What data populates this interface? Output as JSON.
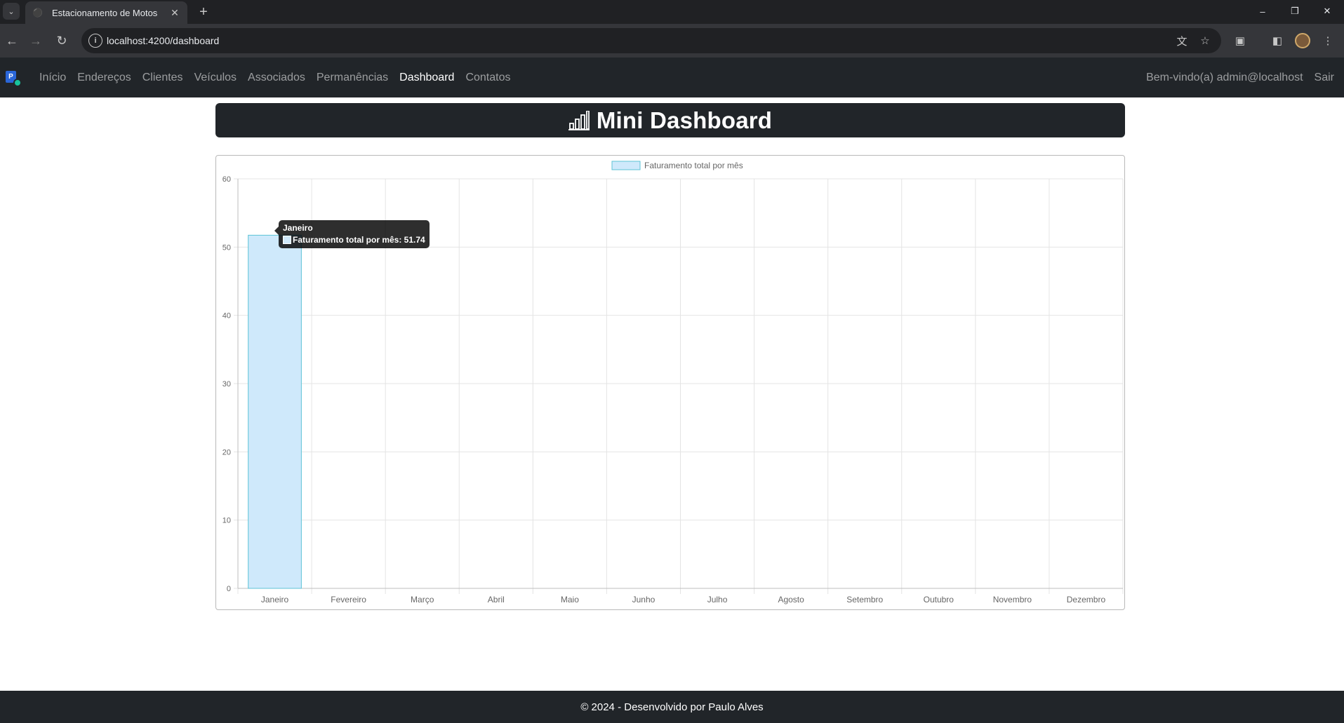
{
  "browser": {
    "tab_title": "Estacionamento de Motos",
    "url": "localhost:4200/dashboard",
    "icons": [
      "tab-search-icon",
      "motorcycle-favicon-icon",
      "close-icon",
      "plus-icon",
      "minimize-icon",
      "restore-icon",
      "close-window-icon",
      "back-icon",
      "forward-icon",
      "reload-icon",
      "site-info-icon",
      "translate-icon",
      "star-icon",
      "extensions-icon",
      "side-panel-icon",
      "profile-avatar",
      "more-menu-icon"
    ]
  },
  "navbar": {
    "links": [
      {
        "label": "Início",
        "active": false
      },
      {
        "label": "Endereços",
        "active": false
      },
      {
        "label": "Clientes",
        "active": false
      },
      {
        "label": "Veículos",
        "active": false
      },
      {
        "label": "Associados",
        "active": false
      },
      {
        "label": "Permanências",
        "active": false
      },
      {
        "label": "Dashboard",
        "active": true
      },
      {
        "label": "Contatos",
        "active": false
      }
    ],
    "welcome": "Bem-vindo(a) admin@localhost",
    "logout": "Sair"
  },
  "header": {
    "title": "Mini Dashboard",
    "icon": "bar-chart-icon"
  },
  "chart_data": {
    "type": "bar",
    "categories": [
      "Janeiro",
      "Fevereiro",
      "Março",
      "Abril",
      "Maio",
      "Junho",
      "Julho",
      "Agosto",
      "Setembro",
      "Outubro",
      "Novembro",
      "Dezembro"
    ],
    "series": [
      {
        "name": "Faturamento total por mês",
        "values": [
          51.74,
          0,
          0,
          0,
          0,
          0,
          0,
          0,
          0,
          0,
          0,
          0
        ]
      }
    ],
    "yticks": [
      0,
      10,
      20,
      30,
      40,
      50,
      60
    ],
    "ylim": [
      0,
      60
    ],
    "grid": true,
    "legend": "top-center",
    "colors": {
      "bar_fill": "#cfe9fb",
      "bar_border": "#5cc3d6"
    },
    "tooltip": {
      "title": "Janeiro",
      "label": "Faturamento total por mês: 51.74"
    }
  },
  "footer": {
    "text": "© 2024 - Desenvolvido por Paulo Alves"
  }
}
